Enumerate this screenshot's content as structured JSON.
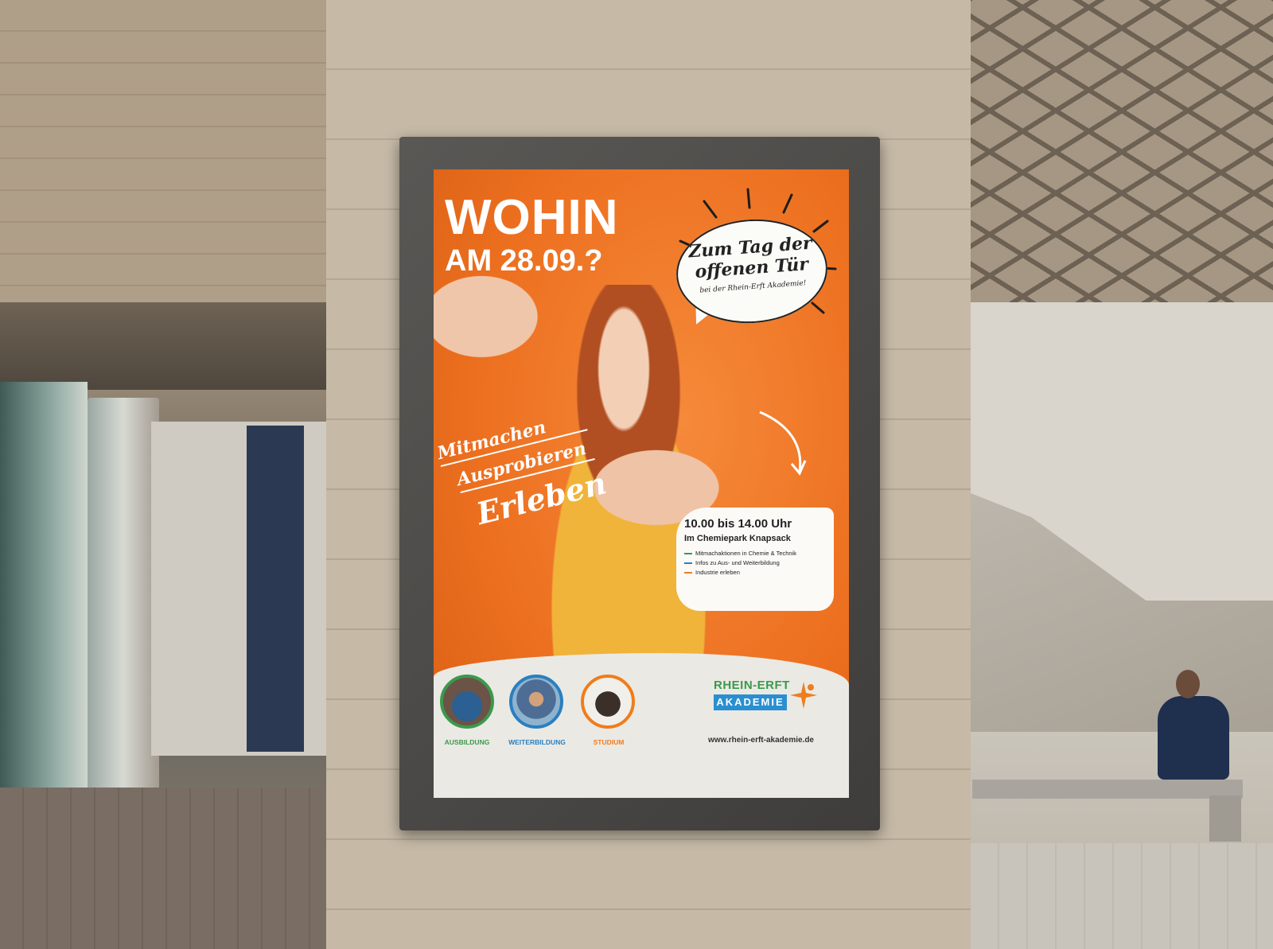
{
  "poster": {
    "headline_line1": "WOHIN",
    "headline_line2": "AM 28.09.?",
    "bubble_line1": "Zum Tag der",
    "bubble_line2": "offenen Tür",
    "bubble_line3": "bei der Rhein-Erft Akademie!",
    "slogan": [
      "Mitmachen",
      "Ausprobieren",
      "Erleben"
    ],
    "info_time": "10.00 bis 14.00 Uhr",
    "info_place": "Im Chemiepark Knapsack",
    "info_items": [
      {
        "text": "Mitmachaktionen in Chemie & Technik",
        "color": "#3a9a4b"
      },
      {
        "text": "Infos zu Aus- und Weiterbildung",
        "color": "#2a7fbf"
      },
      {
        "text": "Industrie erleben",
        "color": "#ef7d1c"
      }
    ],
    "categories": [
      {
        "label": "AUSBILDUNG",
        "color": "#3a9a4b"
      },
      {
        "label": "WEITERBILDUNG",
        "color": "#2a7fbf"
      },
      {
        "label": "STUDIUM",
        "color": "#ef7d1c"
      }
    ],
    "logo_top": "RHEIN-ERFT",
    "logo_bottom": "AKADEMIE",
    "website": "www.rhein-erft-akademie.de",
    "accent_orange": "#ef7d1c"
  }
}
